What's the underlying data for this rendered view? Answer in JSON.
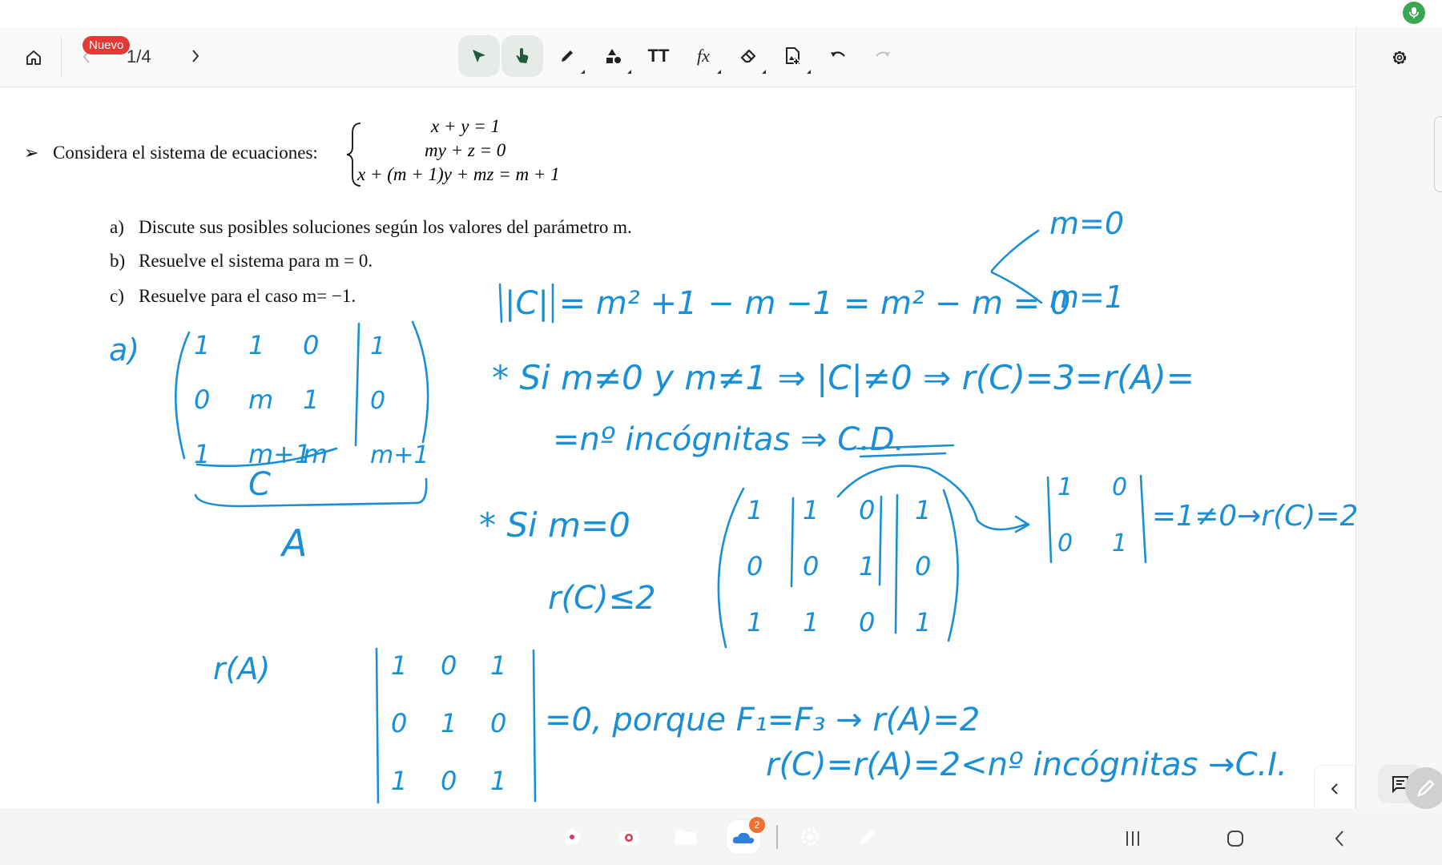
{
  "toolbar": {
    "badge": "Nuevo",
    "page_indicator": "1/4",
    "tools": [
      {
        "name": "select-arrow-icon",
        "active": true
      },
      {
        "name": "hand-pan-icon",
        "active": true
      },
      {
        "name": "pen-icon",
        "active": false
      },
      {
        "name": "shapes-icon",
        "active": false
      },
      {
        "name": "text-icon",
        "active": false
      },
      {
        "name": "formula-icon",
        "active": false
      },
      {
        "name": "eraser-icon",
        "active": false
      },
      {
        "name": "insert-image-icon",
        "active": false
      },
      {
        "name": "undo-icon",
        "active": false
      },
      {
        "name": "redo-icon",
        "active": false
      }
    ],
    "text_tool_label": "TT",
    "formula_tool_label": "fx"
  },
  "problem": {
    "bullet": "➢",
    "lead": "Considera el sistema de ecuaciones:",
    "equations": [
      "x + y = 1",
      "my + z = 0",
      "x + (m + 1)y + mz = m + 1"
    ],
    "items": [
      {
        "letter": "a)",
        "text": "Discute sus posibles soluciones según los valores del parámetro m."
      },
      {
        "letter": "b)",
        "text": "Resuelve el sistema para m = 0."
      },
      {
        "letter": "c)",
        "text": "Resuelve para el caso m= −1."
      }
    ]
  },
  "handwriting": {
    "ink_color": "#1a8fd6",
    "lines": [
      "m=0",
      "|C| = m² +1 − m −1 = m² − m = 0",
      "m=1",
      "a)",
      "* Si m≠0 y m≠1 ⇒ |C|≠0 ⇒ r(C)=3=r(A)=",
      "=nº incógnitas ⇒ C.D.",
      "C",
      "A",
      "* Si m=0",
      "r(C)≤2",
      "=1≠0→r(C)=2",
      "r(A)",
      "=0, porque F₁=F₃ → r(A)=2",
      "r(C)=r(A)=2<nº incógnitas →C.I."
    ],
    "matrix_a": [
      [
        "1",
        "1",
        "0",
        "1"
      ],
      [
        "0",
        "m",
        "1",
        "0"
      ],
      [
        "1",
        "m+1",
        "m",
        "m+1"
      ]
    ],
    "matrix_m0": [
      [
        "1",
        "1",
        "0",
        "1"
      ],
      [
        "0",
        "0",
        "1",
        "0"
      ],
      [
        "1",
        "1",
        "0",
        "1"
      ]
    ],
    "minor": [
      [
        "1",
        "0"
      ],
      [
        "0",
        "1"
      ]
    ],
    "det_ra": [
      [
        "1",
        "0",
        "1"
      ],
      [
        "0",
        "1",
        "0"
      ],
      [
        "1",
        "0",
        "1"
      ]
    ]
  },
  "taskbar": {
    "apps": [
      {
        "name": "flower-app-icon",
        "color": "#e2336b"
      },
      {
        "name": "camera-app-icon",
        "color": "#e0334c"
      },
      {
        "name": "folder-app-icon",
        "color": "#f5a623"
      },
      {
        "name": "onedrive-app-icon",
        "color": "#ffffff"
      },
      {
        "name": "settings-app-icon",
        "color": "#3d4f6b"
      },
      {
        "name": "notes-app-icon",
        "color": "#5b4ad6"
      }
    ],
    "notification_count": "2"
  }
}
